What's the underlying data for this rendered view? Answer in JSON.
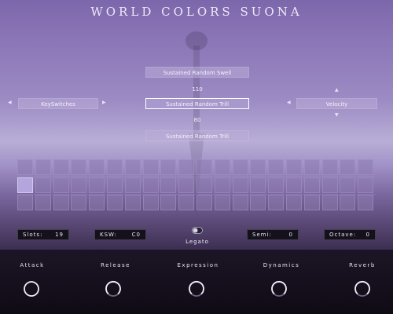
{
  "app": {
    "title": "WORLD COLORS SUONA"
  },
  "articulations": {
    "upper": "Sustained Random Swell",
    "upper_value": "110",
    "selected": "Sustained Random Trill",
    "lower_value": "80",
    "lower": "Sustained Random Trill"
  },
  "keyswitches_label": "KeySwitches",
  "velocity_label": "Velocity",
  "slots": {
    "rows": 3,
    "cols": 20,
    "active_cell": {
      "row": 1,
      "col": 0
    }
  },
  "readouts": {
    "slots_label": "Slots:",
    "slots_value": "19",
    "ksw_label": "KSW:",
    "ksw_value": "C0",
    "semi_label": "Semi:",
    "semi_value": "0",
    "octave_label": "Octave:",
    "octave_value": "0"
  },
  "legato": {
    "label": "Legato",
    "on": false
  },
  "knobs": [
    {
      "label": "Attack"
    },
    {
      "label": "Release"
    },
    {
      "label": "Expression"
    },
    {
      "label": "Dynamics"
    },
    {
      "label": "Reverb"
    }
  ],
  "colors": {
    "accent": "#b4a6dc",
    "panel_dark": "#14101c"
  },
  "icons": {
    "left_arrow": "triangle-left-icon",
    "right_arrow": "triangle-right-icon",
    "up_arrow": "triangle-up-icon",
    "down_arrow": "triangle-down-icon",
    "toggle": "toggle-switch-icon",
    "knob": "rotary-knob-icon"
  }
}
